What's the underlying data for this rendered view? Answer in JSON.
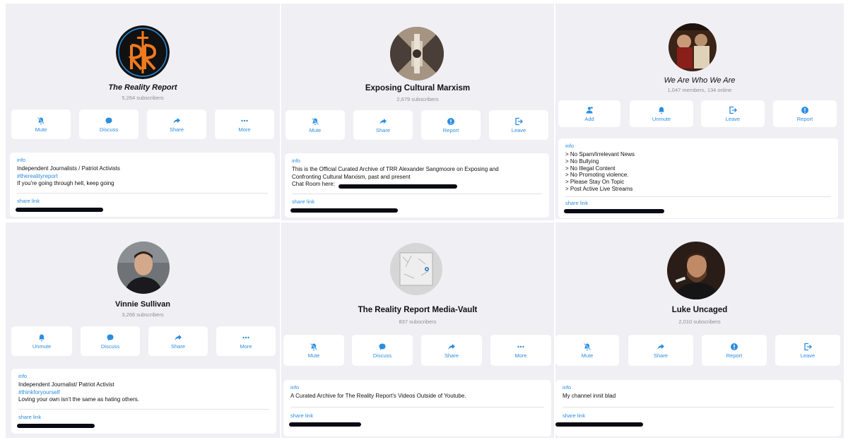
{
  "channels": {
    "tl": {
      "title": "The Reality Report",
      "subscribers": "5,264 subscribers",
      "buttons": [
        "Mute",
        "Discuss",
        "Share",
        "More"
      ],
      "info_label": "info",
      "info_lines": [
        "Independent Journalists / Patriot Activists",
        "#therealityreport",
        "If you're going through hell, keep going"
      ],
      "share_label": "share link"
    },
    "tc": {
      "title": "Exposing Cultural Marxism",
      "subscribers": "2,679 subscribers",
      "buttons": [
        "Mute",
        "Share",
        "Report",
        "Leave"
      ],
      "info_label": "info",
      "info_lines": [
        "This is the Official Curated Archive of TRR Alexander Sangmoore on Exposing and",
        "Confronting Cultural Marxism, past and present",
        "Chat Room here:"
      ],
      "share_label": "share link"
    },
    "tr": {
      "title": "We Are Who We Are",
      "subscribers": "1,047 members, 134 online",
      "buttons": [
        "Add",
        "Unmute",
        "Leave",
        "Report"
      ],
      "info_label": "info",
      "info_lines": [
        "> No Spam/Irrelevant News",
        "> No Bullying",
        "> No Illegal Content",
        "> No Promoting violence.",
        "> Please Stay On Topic",
        "> Post Active Live Streams"
      ],
      "share_label": "share link"
    },
    "bl": {
      "title": "Vinnie Sullivan",
      "subscribers": "3,266 subscribers",
      "buttons": [
        "Unmute",
        "Discuss",
        "Share",
        "More"
      ],
      "info_label": "info",
      "info_lines": [
        "Independent Journalist/ Patriot Activist",
        "#thinkforyourself",
        "Loving your own isn't the same as hating others."
      ],
      "share_label": "share link"
    },
    "bc": {
      "title": "The Reality Report Media-Vault",
      "subscribers": "837 subscribers",
      "buttons": [
        "Mute",
        "Discuss",
        "Share",
        "More"
      ],
      "info_label": "info",
      "info_lines": [
        "A Curated Archive for The Reality Report's Videos Outside of Youtube."
      ],
      "share_label": "share link"
    },
    "br": {
      "title": "Luke Uncaged",
      "subscribers": "2,010 subscribers",
      "buttons": [
        "Mute",
        "Share",
        "Report",
        "Leave"
      ],
      "info_label": "info",
      "info_lines": [
        "My channel innit blad"
      ],
      "share_label": "share link"
    }
  },
  "colors": {
    "accent": "#2b8de0",
    "panel": "#efeff4",
    "card": "#ffffff",
    "muted_text": "#8e8e93"
  }
}
